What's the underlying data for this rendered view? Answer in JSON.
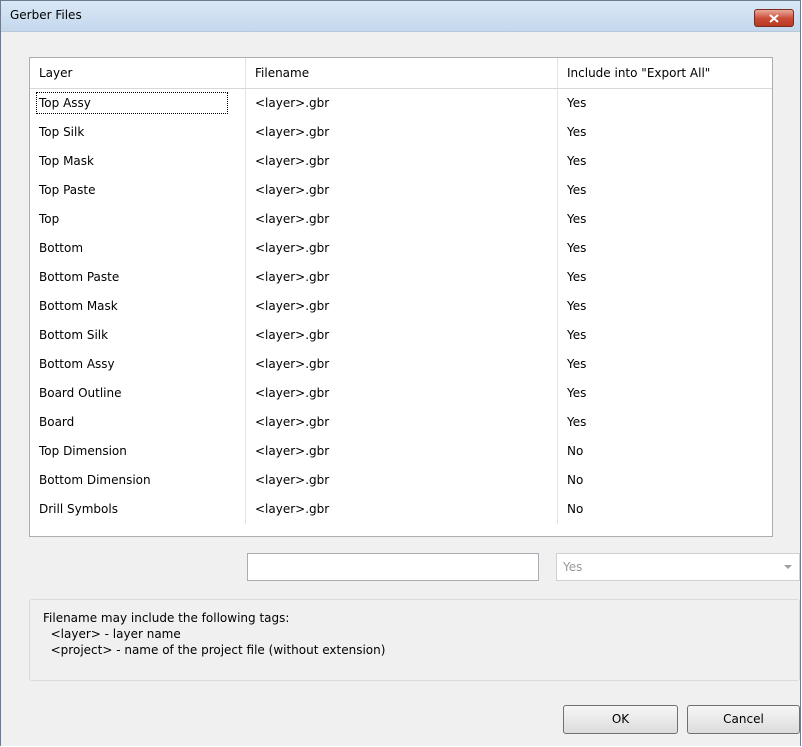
{
  "window": {
    "title": "Gerber Files"
  },
  "table": {
    "columns": [
      "Layer",
      "Filename",
      "Include into \"Export All\""
    ],
    "rows": [
      {
        "layer": "Top Assy",
        "filename": "<layer>.gbr",
        "include": "Yes"
      },
      {
        "layer": "Top Silk",
        "filename": "<layer>.gbr",
        "include": "Yes"
      },
      {
        "layer": "Top Mask",
        "filename": "<layer>.gbr",
        "include": "Yes"
      },
      {
        "layer": "Top Paste",
        "filename": "<layer>.gbr",
        "include": "Yes"
      },
      {
        "layer": "Top",
        "filename": "<layer>.gbr",
        "include": "Yes"
      },
      {
        "layer": "Bottom",
        "filename": "<layer>.gbr",
        "include": "Yes"
      },
      {
        "layer": "Bottom Paste",
        "filename": "<layer>.gbr",
        "include": "Yes"
      },
      {
        "layer": "Bottom Mask",
        "filename": "<layer>.gbr",
        "include": "Yes"
      },
      {
        "layer": "Bottom Silk",
        "filename": "<layer>.gbr",
        "include": "Yes"
      },
      {
        "layer": "Bottom Assy",
        "filename": "<layer>.gbr",
        "include": "Yes"
      },
      {
        "layer": "Board Outline",
        "filename": "<layer>.gbr",
        "include": "Yes"
      },
      {
        "layer": "Board",
        "filename": "<layer>.gbr",
        "include": "Yes"
      },
      {
        "layer": "Top Dimension",
        "filename": "<layer>.gbr",
        "include": "No"
      },
      {
        "layer": "Bottom Dimension",
        "filename": "<layer>.gbr",
        "include": "No"
      },
      {
        "layer": "Drill Symbols",
        "filename": "<layer>.gbr",
        "include": "No"
      }
    ]
  },
  "editor": {
    "filename_value": "",
    "include_select_value": "Yes"
  },
  "info": {
    "lines": [
      "Filename may include the following tags:",
      "  <layer> - layer name",
      "  <project> - name of the project file (without extension)"
    ]
  },
  "buttons": {
    "ok": "OK",
    "cancel": "Cancel"
  },
  "icons": {
    "close": "close-icon",
    "dropdown": "chevron-down-icon"
  }
}
